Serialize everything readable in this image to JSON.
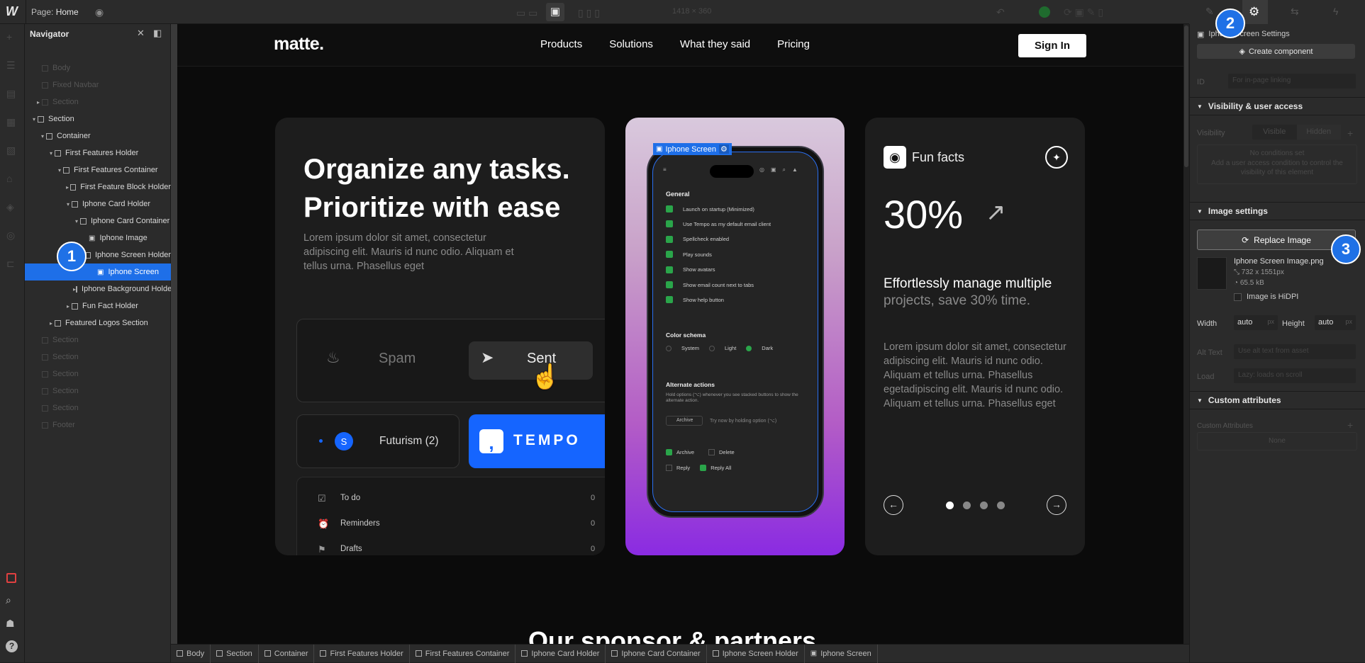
{
  "topbar": {
    "page_label": "Page:",
    "page_name": "Home",
    "size_readout": "1418 × 360"
  },
  "navigator": {
    "title": "Navigator",
    "items": [
      {
        "label": "Body",
        "dim": true
      },
      {
        "label": "Fixed Navbar",
        "dim": true
      },
      {
        "label": "Section",
        "dim": true
      },
      {
        "label": "Section"
      },
      {
        "label": "Container"
      },
      {
        "label": "First Features Holder"
      },
      {
        "label": "First Features Container"
      },
      {
        "label": "First Feature Block Holder"
      },
      {
        "label": "Iphone Card Holder"
      },
      {
        "label": "Iphone Card Container"
      },
      {
        "label": "Iphone Image"
      },
      {
        "label": "Iphone Screen Holder"
      },
      {
        "label": "Iphone Screen"
      },
      {
        "label": "Iphone Background Holder"
      },
      {
        "label": "Fun Fact Holder"
      },
      {
        "label": "Featured Logos Section"
      },
      {
        "label": "Section",
        "dim": true
      },
      {
        "label": "Section",
        "dim": true
      },
      {
        "label": "Section",
        "dim": true
      },
      {
        "label": "Section",
        "dim": true
      },
      {
        "label": "Section",
        "dim": true
      },
      {
        "label": "Footer",
        "dim": true
      }
    ]
  },
  "site": {
    "logo": "matte.",
    "nav": [
      "Products",
      "Solutions",
      "What they said",
      "Pricing"
    ],
    "signin": "Sign In",
    "hero_line1": "Organize any tasks.",
    "hero_line2": "Prioritize with ease",
    "hero_body": "Lorem ipsum dolor sit amet, consectetur adipiscing elit. Mauris id nunc odio. Aliquam et tellus urna. Phasellus eget",
    "spam": "Spam",
    "sent": "Sent",
    "futurism": "Futurism (2)",
    "avatar_letter": "S",
    "tempo": "TEMPO",
    "lists": [
      {
        "label": "To do",
        "count": "0"
      },
      {
        "label": "Reminders",
        "count": "0"
      },
      {
        "label": "Drafts",
        "count": "0"
      }
    ],
    "phone_tag": "Iphone Screen",
    "phone": {
      "general": "General",
      "settings": [
        "Launch on startup (Minimized)",
        "Use Tempo as my default email client",
        "Spellcheck enabled",
        "Play sounds",
        "Show avatars",
        "Show email count next to tabs",
        "Show help button"
      ],
      "color_schema": "Color schema",
      "schema_options": [
        "System",
        "Light",
        "Dark"
      ],
      "alt_actions": "Alternate actions",
      "alt_desc": "Hold options (⌥) whenever you see stacked buttons to show the alternate action.",
      "archive": "Archive",
      "try_now": "Try now by holding option (⌥)",
      "checks": [
        "Archive",
        "Delete",
        "Reply",
        "Reply All"
      ]
    },
    "funfacts": "Fun facts",
    "stat": "30%",
    "fun_title": "Effortlessly manage multiple",
    "fun_sub": "projects, save 30% time.",
    "fun_body": "Lorem ipsum dolor sit amet, consectetur adipiscing elit. Mauris id nunc odio. Aliquam et tellus urna. Phasellus egetadipiscing elit. Mauris id nunc odio. Aliquam et tellus urna. Phasellus eget",
    "sponsor_heading": "Our sponsor & partners"
  },
  "right_panel": {
    "settings_title": "Iphone Screen Settings",
    "create_component": "Create component",
    "id_label": "ID",
    "id_placeholder": "For in-page linking",
    "visibility_heading": "Visibility & user access",
    "visibility_label": "Visibility",
    "visible": "Visible",
    "hidden": "Hidden",
    "no_conditions": "No conditions set",
    "add_condition": "Add a user access condition to control the visibility of this element",
    "image_settings": "Image settings",
    "replace_image": "Replace Image",
    "file_name": "Iphone Screen Image.png",
    "file_dims": "732 x 1551px",
    "file_size": "65.5 kB",
    "hidpi": "Image is HiDPI",
    "width_label": "Width",
    "width_value": "auto",
    "height_label": "Height",
    "height_value": "auto",
    "unit": "px",
    "alt_label": "Alt Text",
    "alt_value": "Use alt text from asset",
    "load_label": "Load",
    "load_value": "Lazy: loads on scroll",
    "custom_attrs": "Custom attributes",
    "custom_attrs_label": "Custom Attributes",
    "none": "None"
  },
  "breadcrumbs": [
    "Body",
    "Section",
    "Container",
    "First Features Holder",
    "First Features Container",
    "Iphone Card Holder",
    "Iphone Card Container",
    "Iphone Screen Holder",
    "Iphone Screen"
  ],
  "badges": [
    "1",
    "2",
    "3"
  ],
  "colors": {
    "accent": "#1e6fe8",
    "tempo_blue": "#1565ff",
    "check_green": "#2aa54a"
  }
}
